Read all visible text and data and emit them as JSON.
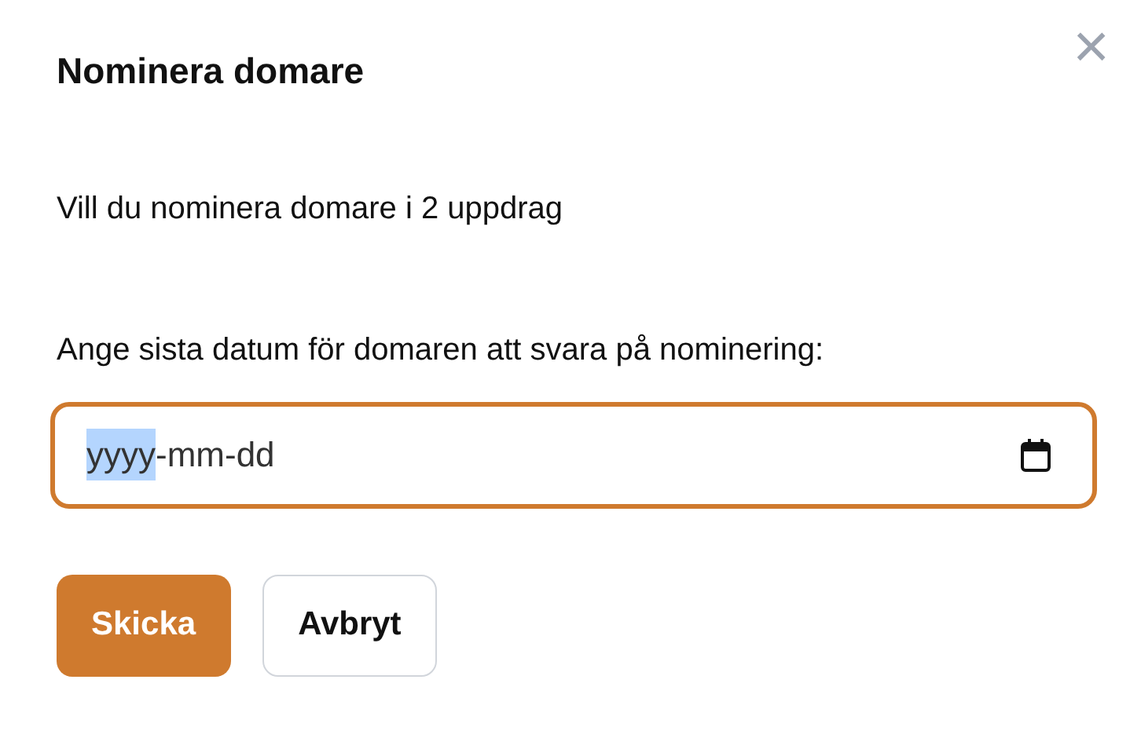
{
  "dialog": {
    "title": "Nominera domare",
    "close": "×",
    "message": "Vill du nominera domare i 2 uppdrag",
    "date_label": "Ange sista datum för domaren att svara på nominering:",
    "date_field": {
      "focused": true,
      "segments": [
        {
          "text": "yyyy",
          "selected": true
        },
        {
          "text": "-",
          "selected": false
        },
        {
          "text": "mm",
          "selected": false
        },
        {
          "text": "-",
          "selected": false
        },
        {
          "text": "dd",
          "selected": false
        }
      ]
    },
    "buttons": [
      {
        "label": "Skicka",
        "kind": "primary"
      },
      {
        "label": "Avbryt",
        "kind": "secondary"
      }
    ]
  }
}
